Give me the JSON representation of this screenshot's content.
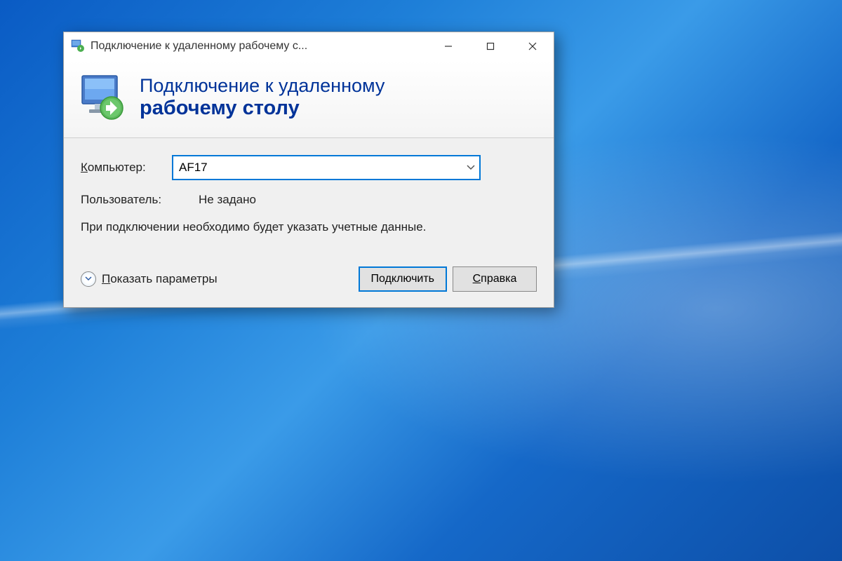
{
  "window": {
    "title": "Подключение к удаленному рабочему с..."
  },
  "header": {
    "line1": "Подключение к удаленному",
    "line2": "рабочему столу"
  },
  "form": {
    "computer_label": "Компьютер:",
    "computer_value": "AF17",
    "user_label": "Пользователь:",
    "user_value": "Не задано",
    "hint": "При подключении необходимо будет указать учетные данные."
  },
  "footer": {
    "show_options": "Показать параметры",
    "connect": "Подключить",
    "help": "Справка"
  }
}
